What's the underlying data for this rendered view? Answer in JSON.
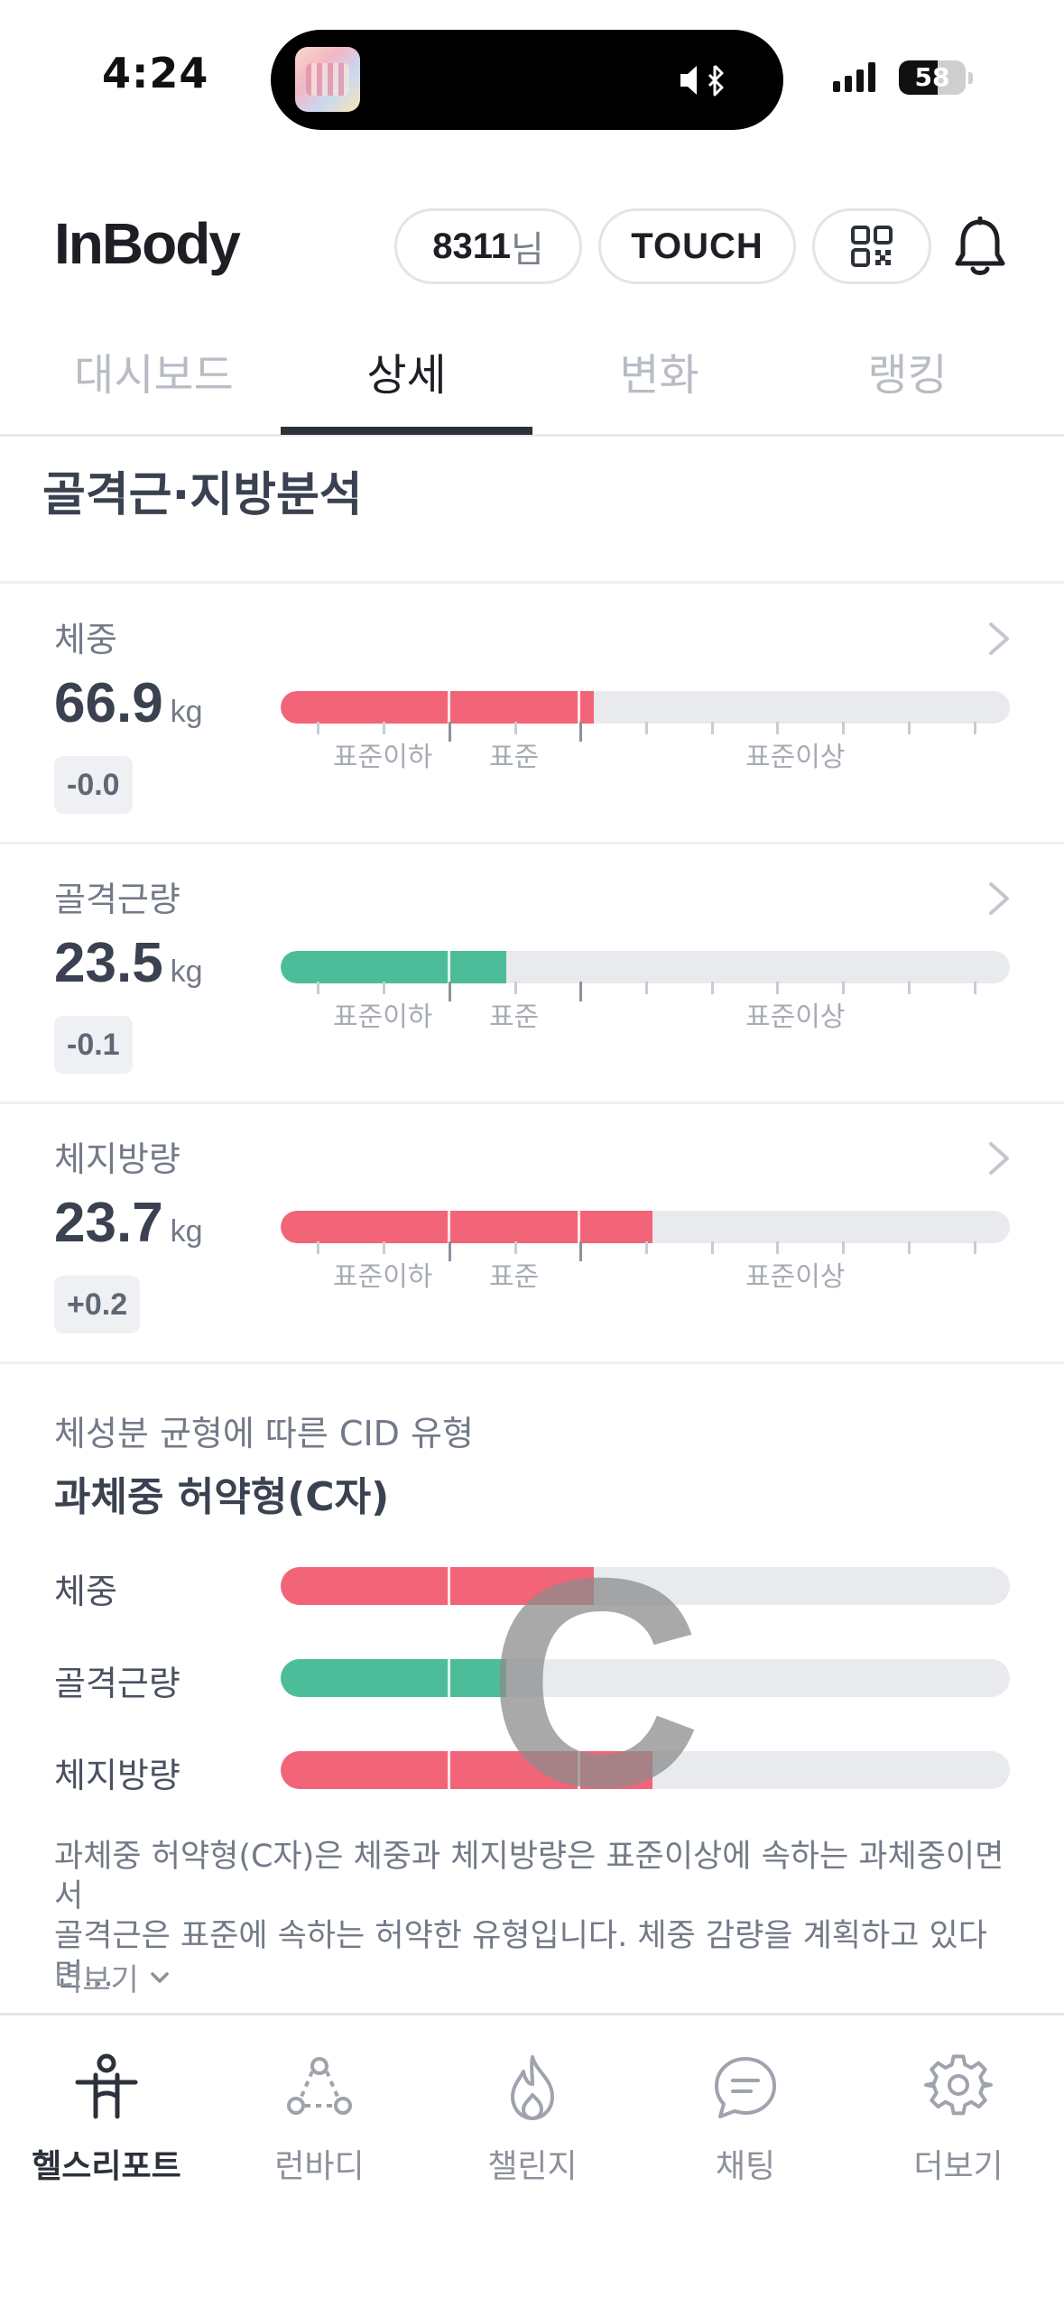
{
  "status_bar": {
    "time": "4:24",
    "battery": "58",
    "battery_level": 0.58
  },
  "header": {
    "logo": "InBody",
    "user_id": "8311",
    "user_suffix": "님",
    "touch_label": "TOUCH"
  },
  "tabs": [
    {
      "label": "대시보드",
      "active": false
    },
    {
      "label": "상세",
      "active": true
    },
    {
      "label": "변화",
      "active": false
    },
    {
      "label": "랭킹",
      "active": false
    }
  ],
  "section_title": "골격근·지방분석",
  "scale_labels": {
    "below": "표준이하",
    "standard": "표준",
    "above": "표준이상"
  },
  "metrics": [
    {
      "label": "체중",
      "value": "66.9",
      "unit": "kg",
      "delta": "-0.0",
      "color": "#f26478",
      "fill_fraction": 0.43
    },
    {
      "label": "골격근량",
      "value": "23.5",
      "unit": "kg",
      "delta": "-0.1",
      "color": "#4cbd98",
      "fill_fraction": 0.31
    },
    {
      "label": "체지방량",
      "value": "23.7",
      "unit": "kg",
      "delta": "+0.2",
      "color": "#f26478",
      "fill_fraction": 0.51
    }
  ],
  "cid": {
    "subtitle": "체성분 균형에 따른 CID 유형",
    "title": "과체중 허약형(C자)",
    "letter": "C",
    "bars": [
      {
        "label": "체중",
        "fill_fraction": 0.43,
        "color": "#f26478"
      },
      {
        "label": "골격근량",
        "fill_fraction": 0.31,
        "color": "#4cbd98"
      },
      {
        "label": "체지방량",
        "fill_fraction": 0.51,
        "color": "#f26478"
      }
    ],
    "description_line1": "과체중 허약형(C자)은 체중과 체지방량은 표준이상에 속하는 과체중이면서",
    "description_line2": "골격근은 표준에 속하는 허약한 유형입니다. 체중 감량을 계획하고 있다면...",
    "more_label": "더보기"
  },
  "bottom_nav": [
    {
      "label": "헬스리포트",
      "icon": "person-icon",
      "active": true
    },
    {
      "label": "런바디",
      "icon": "network-icon",
      "active": false
    },
    {
      "label": "챌린지",
      "icon": "flame-icon",
      "active": false
    },
    {
      "label": "채팅",
      "icon": "chat-icon",
      "active": false
    },
    {
      "label": "더보기",
      "icon": "gear-icon",
      "active": false
    }
  ]
}
